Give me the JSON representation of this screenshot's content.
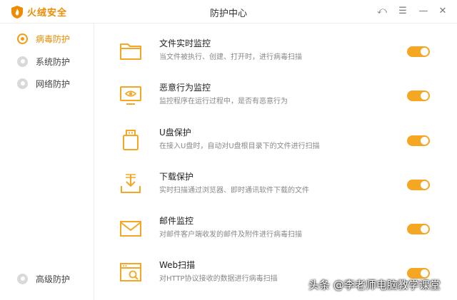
{
  "app": {
    "name": "火绒安全",
    "window_title": "防护中心",
    "accent": "#f5a623"
  },
  "window_controls": {
    "back": "⤺",
    "menu": "☰",
    "minimize": "—",
    "close": "✕"
  },
  "sidebar": {
    "items": [
      {
        "label": "病毒防护",
        "active": true
      },
      {
        "label": "系统防护",
        "active": false
      },
      {
        "label": "网络防护",
        "active": false
      }
    ],
    "bottom_item": {
      "label": "高级防护"
    }
  },
  "protections": [
    {
      "icon": "folder-icon",
      "title": "文件实时监控",
      "desc": "当文件被执行、创建、打开时，进行病毒扫描",
      "enabled": true
    },
    {
      "icon": "monitor-eye-icon",
      "title": "恶意行为监控",
      "desc": "监控程序在运行过程中，是否有恶意行为",
      "enabled": true
    },
    {
      "icon": "usb-drive-icon",
      "title": "U盘保护",
      "desc": "在接入U盘时，自动对U盘根目录下的文件进行扫描",
      "enabled": true
    },
    {
      "icon": "download-tray-icon",
      "title": "下载保护",
      "desc": "实时扫描通过浏览器、即时通讯软件下载的文件",
      "enabled": true
    },
    {
      "icon": "mail-icon",
      "title": "邮件监控",
      "desc": "对邮件客户端收发的邮件及附件进行病毒扫描",
      "enabled": true
    },
    {
      "icon": "web-browser-icon",
      "title": "Web扫描",
      "desc": "对HTTP协议接收的数据进行病毒扫描",
      "enabled": true
    }
  ],
  "watermark": "头条 @李老师电脑教学课堂"
}
